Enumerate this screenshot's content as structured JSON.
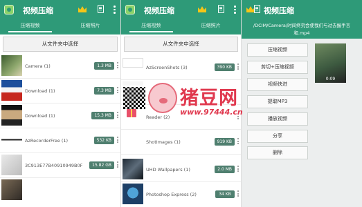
{
  "app": {
    "title": "视频压缩"
  },
  "tabs": [
    "压缩视频",
    "压缩照片"
  ],
  "pick_button": "从文件夹中选择",
  "panel1": {
    "folders": [
      {
        "name": "Camera (1)",
        "size": "1.3 MB"
      },
      {
        "name": "Download (1)",
        "size": "7.3 MB"
      },
      {
        "name": "Download (1)",
        "size": "15.3 MB"
      },
      {
        "name": "AzRecorderFree (1)",
        "size": "532 KB"
      },
      {
        "name": "3C913E77B40910949B0F",
        "size": "15.82 GB"
      }
    ]
  },
  "panel2": {
    "folders": [
      {
        "name": "AzScreenShots (3)",
        "size": "390 KB"
      },
      {
        "name": "",
        "size": ""
      },
      {
        "name": "Reader (2)",
        "size": ""
      },
      {
        "name": "ShotImages (1)",
        "size": "919 KB"
      },
      {
        "name": "UHD Wallpapers (1)",
        "size": "2.0 MB"
      },
      {
        "name": "Photoshop Express (2)",
        "size": "34 KB"
      }
    ]
  },
  "panel3": {
    "file_path": "/DCIM/Camera/时间终究会使我们与过去握手言和.mp4",
    "actions": [
      "压缩视频",
      "剪切+压缩视频",
      "视频快进",
      "提取MP3",
      "播放视频",
      "分享",
      "删除"
    ],
    "preview_duration": "0:09"
  },
  "watermark": {
    "brand": "猪豆网",
    "url": "www.97444.cn"
  },
  "colors": {
    "primary": "#2e9a78",
    "badge": "#4f7f6f",
    "crown": "#f5c518"
  },
  "icons": [
    "app-logo-icon",
    "vip-crown-icon",
    "document-icon",
    "more-vert-icon"
  ]
}
